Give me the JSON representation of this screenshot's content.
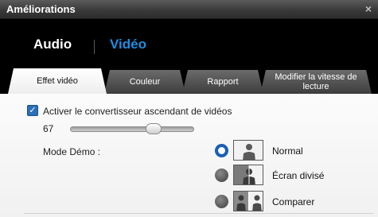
{
  "window": {
    "title": "Améliorations",
    "close_symbol": "×"
  },
  "mode_tabs": {
    "audio": "Audio",
    "video": "Vidéo",
    "active": "video",
    "active_color": "#1c8fe3"
  },
  "tabs": [
    {
      "label": "Effet vidéo",
      "active": true
    },
    {
      "label": "Couleur",
      "active": false
    },
    {
      "label": "Rapport",
      "active": false
    },
    {
      "label": "Modifier la vitesse de lecture",
      "active": false
    }
  ],
  "effect": {
    "upconvert_checkbox": {
      "label": "Activer le convertisseur ascendant de vidéos",
      "checked": true,
      "check_symbol": "✓"
    },
    "slider": {
      "value_label": "67",
      "value": 67,
      "min": 0,
      "max": 100
    },
    "demo_mode": {
      "label": "Mode Démo :",
      "options": [
        {
          "label": "Normal",
          "selected": true,
          "icon": "person-full-icon"
        },
        {
          "label": "Écran divisé",
          "selected": false,
          "icon": "person-split-icon"
        },
        {
          "label": "Comparer",
          "selected": false,
          "icon": "person-compare-icon"
        }
      ]
    }
  },
  "colors": {
    "accent": "#1c8fe3",
    "checkbox": "#2b6fb8",
    "radio_selected": "#1a5fb4"
  }
}
